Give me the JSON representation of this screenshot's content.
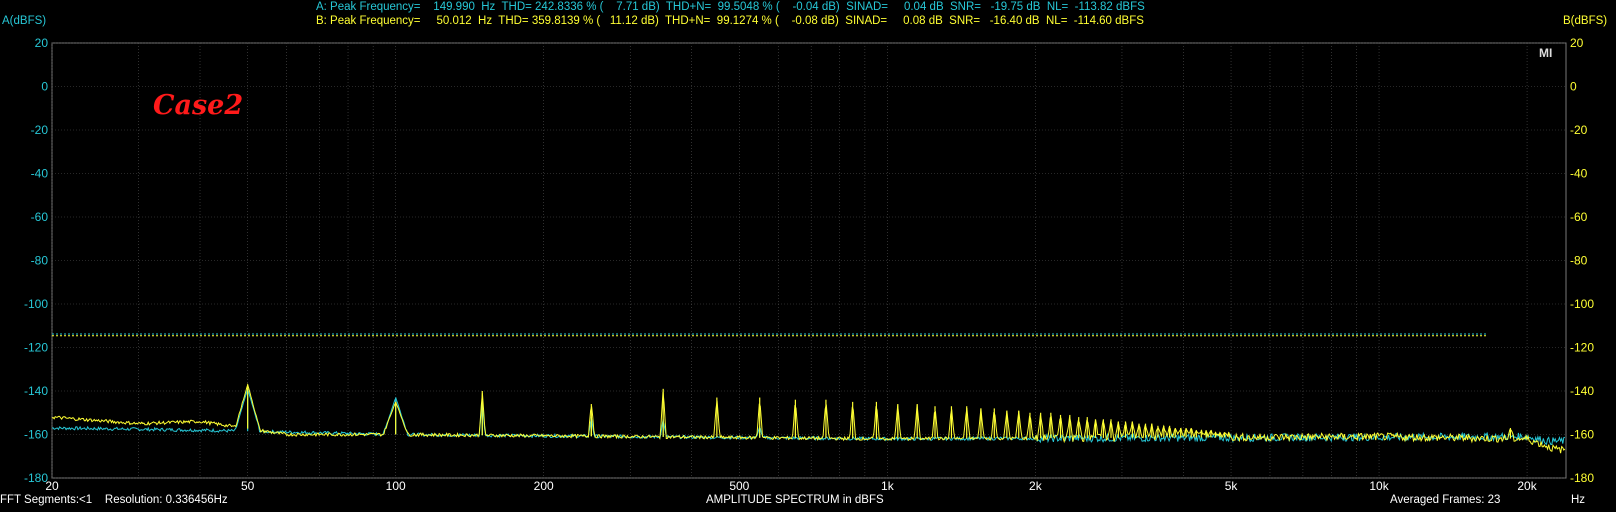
{
  "header": {
    "line_a": "A: Peak Frequency=    149.990  Hz  THD= 242.8336 % (    7.71 dB)  THD+N=  99.5048 % (    -0.04 dB)  SINAD=     0.04 dB  SNR=   -19.75 dB  NL=  -113.82 dBFS",
    "line_b": "B: Peak Frequency=     50.012  Hz  THD= 359.8139 % (   11.12 dB)  THD+N=  99.1274 % (    -0.08 dB)  SINAD=     0.08 dB  SNR=   -16.40 dB  NL=  -114.60 dBFS",
    "left_axis_label": "A(dBFS)",
    "right_axis_label": "B(dBFS)"
  },
  "footer": {
    "left": "FFT Segments:<1    Resolution: 0.336456Hz",
    "center": "AMPLITUDE SPECTRUM in dBFS",
    "right": "Averaged Frames: 23",
    "unit": "Hz"
  },
  "annotation": "Case2",
  "badge": "MI",
  "colors": {
    "series_a": "#27c7d6",
    "series_b": "#ffff33",
    "grid": "#505050",
    "text": "#ffffff"
  },
  "chart_data": {
    "type": "line",
    "title": "AMPLITUDE SPECTRUM in dBFS",
    "xlabel": "Hz",
    "ylabel_left": "A(dBFS)",
    "ylabel_right": "B(dBFS)",
    "x_scale": "log",
    "xlim": [
      20,
      24000
    ],
    "ylim": [
      -180,
      20
    ],
    "grid": true,
    "x_ticks": [
      20,
      50,
      100,
      200,
      500,
      1000,
      2000,
      5000,
      10000,
      20000
    ],
    "x_tick_labels": [
      "20",
      "50",
      "100",
      "200",
      "500",
      "1k",
      "2k",
      "5k",
      "10k",
      "20k"
    ],
    "y_ticks": [
      20,
      0,
      -20,
      -40,
      -60,
      -80,
      -100,
      -120,
      -140,
      -160,
      -180
    ],
    "noise_floor_level": {
      "A": -113.82,
      "B": -114.6
    },
    "series": [
      {
        "name": "A",
        "color": "#27c7d6",
        "baseline": [
          [
            20,
            -157
          ],
          [
            40,
            -158
          ],
          [
            100,
            -160
          ],
          [
            1000,
            -162
          ],
          [
            20000,
            -161
          ],
          [
            22000,
            -163
          ]
        ],
        "peaks": [
          [
            50,
            -139
          ],
          [
            100,
            -143
          ],
          [
            150,
            -145
          ],
          [
            250,
            -152
          ],
          [
            350,
            -153
          ],
          [
            550,
            -156
          ]
        ]
      },
      {
        "name": "B",
        "color": "#ffff33",
        "baseline": [
          [
            20,
            -152
          ],
          [
            30,
            -155
          ],
          [
            40,
            -154
          ],
          [
            60,
            -160
          ],
          [
            100,
            -160
          ],
          [
            1000,
            -162
          ],
          [
            10000,
            -161
          ],
          [
            20000,
            -162
          ],
          [
            23000,
            -167
          ]
        ],
        "peaks": [
          [
            50,
            -137
          ],
          [
            100,
            -145
          ],
          [
            150,
            -140
          ],
          [
            250,
            -156
          ],
          [
            250,
            -146
          ],
          [
            350,
            -139
          ],
          [
            450,
            -143
          ],
          [
            550,
            -143
          ],
          [
            650,
            -144
          ],
          [
            750,
            -144
          ],
          [
            850,
            -145
          ],
          [
            950,
            -145
          ],
          [
            1050,
            -146
          ],
          [
            1150,
            -146
          ],
          [
            1250,
            -147
          ],
          [
            1350,
            -147
          ],
          [
            1450,
            -147
          ],
          [
            1550,
            -148
          ],
          [
            1650,
            -148
          ],
          [
            1750,
            -149
          ],
          [
            1850,
            -149
          ],
          [
            1950,
            -150
          ],
          [
            2050,
            -150
          ],
          [
            2150,
            -150
          ],
          [
            2250,
            -151
          ],
          [
            2350,
            -151
          ],
          [
            2450,
            -152
          ],
          [
            2550,
            -152
          ],
          [
            2650,
            -153
          ],
          [
            2750,
            -153
          ],
          [
            2850,
            -153
          ],
          [
            2950,
            -154
          ],
          [
            3050,
            -154
          ],
          [
            3150,
            -154
          ],
          [
            3250,
            -155
          ],
          [
            3350,
            -155
          ],
          [
            3450,
            -155
          ],
          [
            3550,
            -156
          ],
          [
            3650,
            -156
          ],
          [
            3750,
            -156
          ],
          [
            3850,
            -157
          ],
          [
            3950,
            -157
          ],
          [
            4050,
            -157
          ],
          [
            4150,
            -157
          ],
          [
            4250,
            -158
          ],
          [
            4350,
            -158
          ],
          [
            4450,
            -158
          ],
          [
            4550,
            -158
          ],
          [
            4650,
            -159
          ],
          [
            4750,
            -159
          ],
          [
            4850,
            -159
          ],
          [
            4950,
            -159
          ],
          [
            18500,
            -157
          ]
        ]
      }
    ]
  }
}
